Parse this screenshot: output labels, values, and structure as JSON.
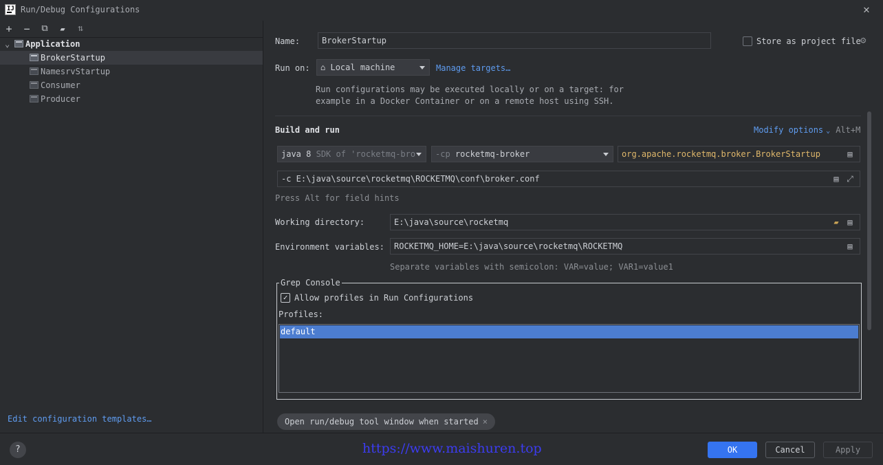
{
  "window": {
    "title": "Run/Debug Configurations",
    "logo": "IJ"
  },
  "toolbar": {
    "buttons": [
      {
        "name": "add-icon",
        "glyph": "+"
      },
      {
        "name": "remove-icon",
        "glyph": "−"
      },
      {
        "name": "copy-icon",
        "glyph": "⧉"
      },
      {
        "name": "folder-icon",
        "glyph": "▰"
      },
      {
        "name": "sort-icon",
        "glyph": "⇅"
      }
    ]
  },
  "tree": {
    "group": "Application",
    "items": [
      "BrokerStartup",
      "NamesrvStartup",
      "Consumer",
      "Producer"
    ],
    "edit_templates": "Edit configuration templates…"
  },
  "form": {
    "name_label": "Name:",
    "name_value": "BrokerStartup",
    "store_label": "Store as project file",
    "run_on_label": "Run on:",
    "run_on_value": "Local machine",
    "manage_targets": "Manage targets…",
    "run_on_hint_1": "Run configurations may be executed locally or on a target: for",
    "run_on_hint_2": "example in a Docker Container or on a remote host using SSH.",
    "build_run_label": "Build and run",
    "modify_options": "Modify options",
    "modify_shortcut": "Alt+M",
    "jdk_value": "java 8",
    "jdk_detail": "SDK of 'rocketmq-bro",
    "cp_prefix": "-cp",
    "cp_value": "rocketmq-broker",
    "main_class": "org.apache.rocketmq.broker.BrokerStartup",
    "program_args": "-c E:\\java\\source\\rocketmq\\ROCKETMQ\\conf\\broker.conf",
    "field_hints": "Press Alt for field hints",
    "workdir_label": "Working directory:",
    "workdir_value": "E:\\java\\source\\rocketmq",
    "env_label": "Environment variables:",
    "env_value": "ROCKETMQ_HOME=E:\\java\\source\\rocketmq\\ROCKETMQ",
    "env_hint": "Separate variables with semicolon: VAR=value; VAR1=value1"
  },
  "grep": {
    "title": "Grep Console",
    "allow_label": "Allow profiles in Run Configurations",
    "allow_checked": true,
    "profiles_label": "Profiles:",
    "profiles": [
      "default"
    ]
  },
  "chip": {
    "label": "Open run/debug tool window when started",
    "close": "×"
  },
  "footer": {
    "help": "?",
    "watermark": "https://www.maishuren.top",
    "ok": "OK",
    "cancel": "Cancel",
    "apply": "Apply"
  },
  "colors": {
    "accent": "#3574f0",
    "link": "#5f9cf0",
    "selection": "#4c7dd0",
    "main_class": "#e0b86b"
  }
}
